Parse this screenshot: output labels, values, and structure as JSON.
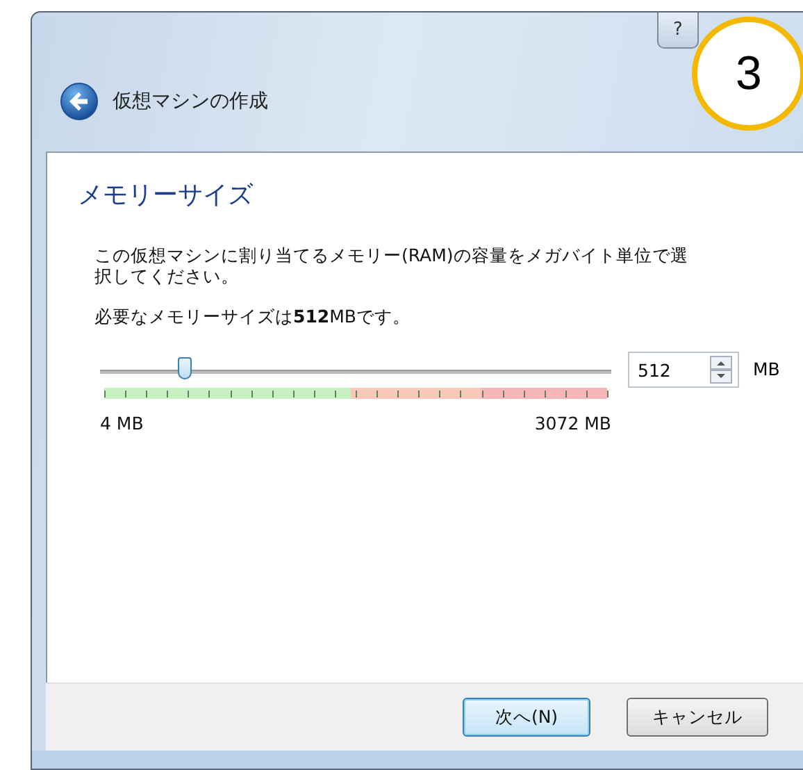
{
  "window": {
    "title": "仮想マシンの作成",
    "help_button": "?"
  },
  "step_badge": "3",
  "page": {
    "heading": "メモリーサイズ",
    "description": "この仮想マシンに割り当てるメモリー(RAM)の容量をメガバイト単位で選択してください。",
    "recommendation": "必要なメモリーサイズは**512**MBです。"
  },
  "memory": {
    "level": 0.166,
    "value": "512",
    "unit": "MB",
    "min_label": "4 MB",
    "max_label": "3072 MB"
  },
  "buttons": [
    {
      "label": "次へ(N)",
      "default": true
    },
    {
      "label": "キャンセル",
      "default": false
    }
  ]
}
